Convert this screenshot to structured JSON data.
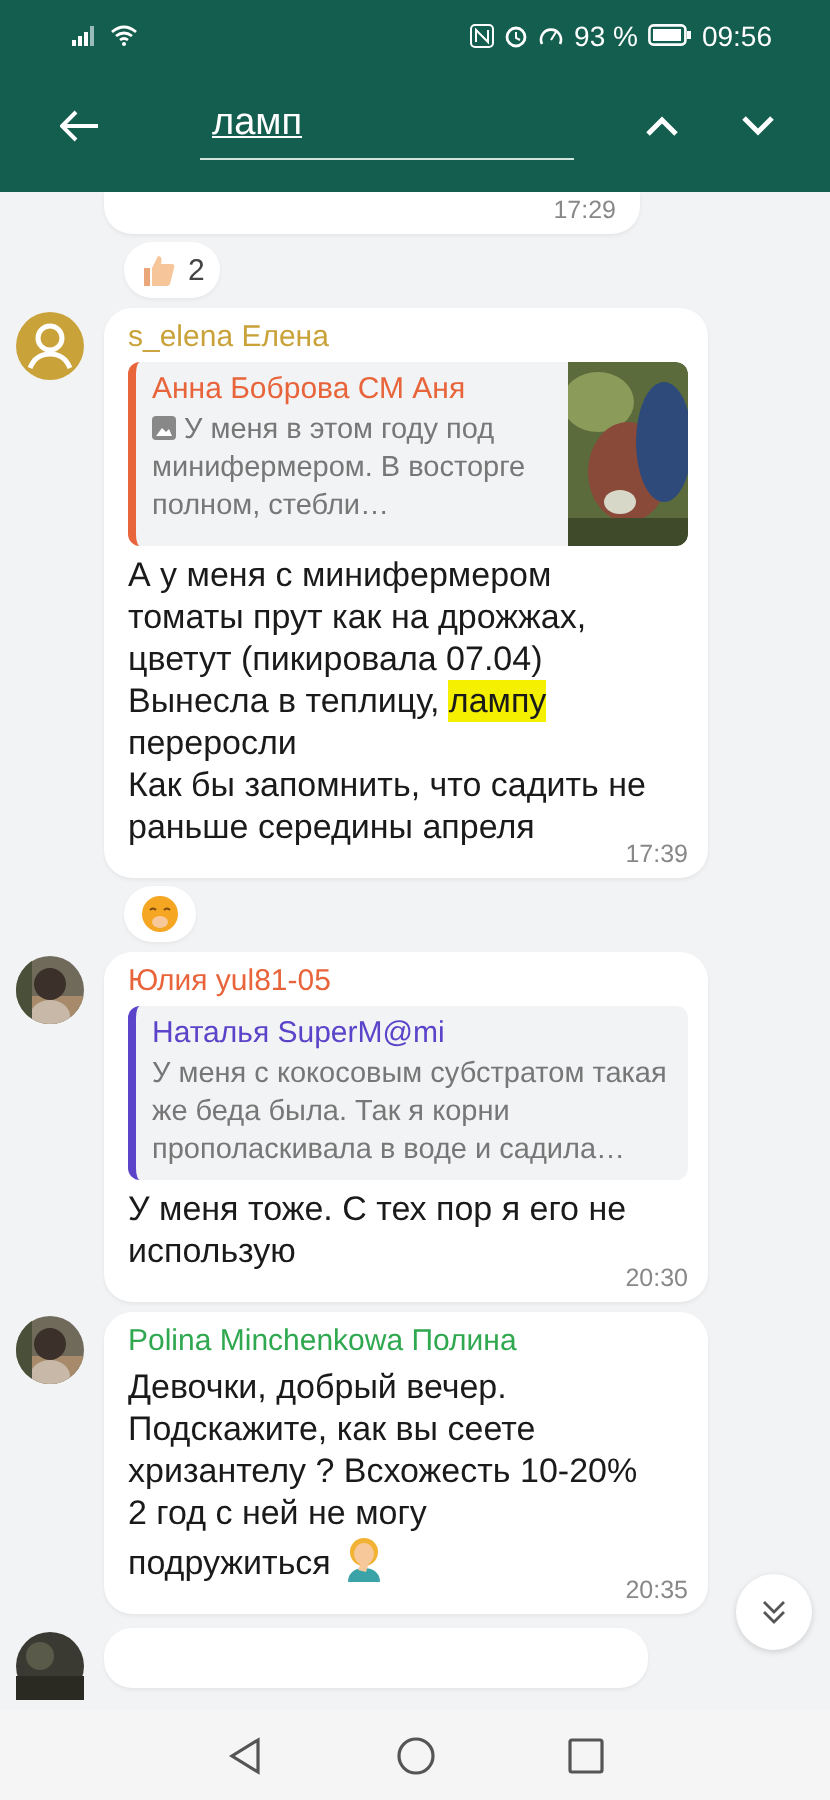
{
  "status_bar": {
    "battery_text": "93 %",
    "time": "09:56"
  },
  "search": {
    "value": "ламп"
  },
  "messages": [
    {
      "kind": "partial_top",
      "time": "17:29",
      "reactions": [
        {
          "kind": "thumbs_up",
          "count": "2"
        }
      ]
    },
    {
      "kind": "message",
      "avatar": {
        "kind": "silhouette"
      },
      "author": "s_elena Елена",
      "color": "#c9a23a",
      "quote": {
        "author": "Анна Боброва СМ Аня",
        "color": "#e8643a",
        "has_photo": true,
        "text": "У меня в этом году под минифермером. В восторге полном, стебли…"
      },
      "parts": [
        {
          "text": "А у меня с минифермером томаты прут как на дрожжах, цветут (пикировала 07.04)\nВынесла в теплицу, ",
          "highlighted": false
        },
        {
          "text": "лампу",
          "highlighted": true
        },
        {
          "text": "\nпереросли\nКак бы запомнить, что садить не раньше середины апреля",
          "highlighted": false
        }
      ],
      "time": "17:39",
      "reactions": [
        {
          "kind": "smiley"
        }
      ]
    },
    {
      "kind": "message",
      "author": "Юлия yul81-05",
      "color": "#e8643a",
      "quote": {
        "author": "Наталья SuperM@mi",
        "color": "#5b44c9",
        "has_photo": false,
        "text": "У меня с кокосовым субстратом такая же беда была. Так я корни прополаскивала в воде и садила…"
      },
      "parts": [
        {
          "text": "У меня тоже. С тех пор я его не использую",
          "highlighted": false
        }
      ],
      "time": "20:30"
    },
    {
      "kind": "message",
      "author": "Polina Minchenkowa Полина",
      "color": "#2fa84f",
      "parts": [
        {
          "text": "Девочки, добрый вечер.\nПодскажите, как вы сеете хризантелу ? Всхожесть 10-20%\n2 год с ней не могу\nподружиться",
          "highlighted": false
        }
      ],
      "trailing_emoji": {
        "kind": "facepalm"
      },
      "time": "20:35"
    },
    {
      "kind": "partial_bottom"
    }
  ]
}
